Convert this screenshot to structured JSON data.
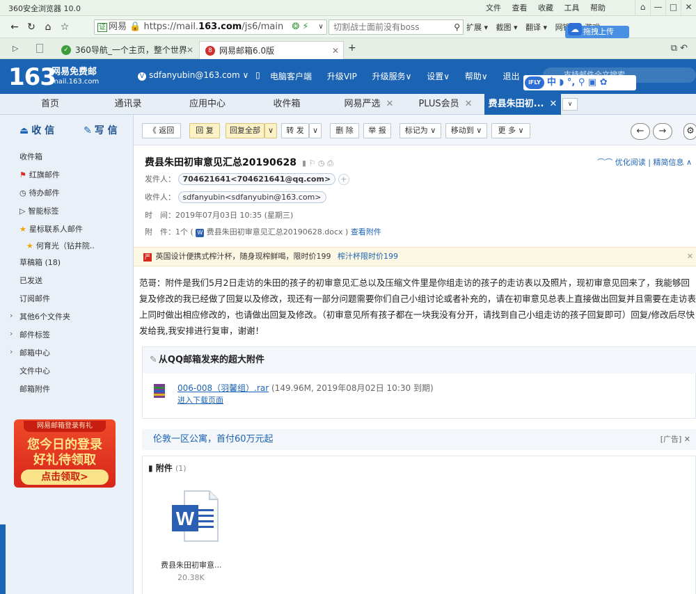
{
  "browser": {
    "title": "360安全浏览器 10.0",
    "menu": [
      "文件",
      "查看",
      "收藏",
      "工具",
      "帮助"
    ],
    "window_controls": [
      "⌂",
      "—",
      "□",
      "✕"
    ],
    "url_prefix": "网易",
    "url_plain": "https://mail.",
    "url_bold": "163.com",
    "url_tail": "/js6/main",
    "search_text": "切割战士面前没有boss",
    "toolbar_items": [
      "扩展 ▾",
      "截图 ▾",
      "翻译 ▾",
      "网银 ▾",
      "游戏 ▾",
      "»"
    ],
    "upload_tip": "拖拽上传",
    "tabs": [
      {
        "label": "360导航_一个主页，整个世界",
        "fav": "✓"
      },
      {
        "label": "网易邮箱6.0版",
        "fav": "8"
      }
    ]
  },
  "mail": {
    "logo_number": "163",
    "logo_title": "网易免费邮",
    "logo_domain": "mail.163.com",
    "account": "sdfanyubin@163.com ∨",
    "header_links": [
      "电脑客户端",
      "升级VIP",
      "升级服务∨",
      "设置∨",
      "帮助∨",
      "退出"
    ],
    "search_placeholder": "支持邮件全文搜索",
    "ifly_logo": "iFLY",
    "ifly_text": "中 ◗ °, ⚲ ▣ ✿",
    "nav_tabs": [
      "首页",
      "通讯录",
      "应用中心",
      "收件箱",
      "网易严选",
      "PLUS会员",
      "费县朱田初..."
    ],
    "sidebar": {
      "receive": "收 信",
      "write": "写 信",
      "items": [
        "收件箱",
        "红旗邮件",
        "待办邮件",
        "智能标签",
        "星标联系人邮件",
        "何育光（钻井院..",
        "草稿箱 (18)",
        "已发送",
        "订阅邮件",
        "其他6个文件夹",
        "邮件标签",
        "邮箱中心",
        "文件中心",
        "邮箱附件"
      ],
      "promo_top": "网易邮箱登录有礼",
      "promo_line1": "您今日的登录",
      "promo_line2": "好礼待领取",
      "promo_button": "点击领取>"
    },
    "actions": [
      "《 返回",
      "回 复",
      "回复全部",
      "∨",
      "转 发",
      "∨",
      "删 除",
      "举 报",
      "标记为 ∨",
      "移动到 ∨",
      "更 多 ∨"
    ],
    "subject": "费县朱田初审意见汇总20190628",
    "subject_icons": "▮ ⚐ ◷ ⎙",
    "read_options": "⌒⌒ 优化阅读 | 精简信息 ∧",
    "from_label": "发件人：",
    "from_value": "704621641<704621641@qq.com>",
    "to_label": "收件人：",
    "to_value": "sdfanyubin<sdfanyubin@163.com>",
    "time_label": "时　间：",
    "time_value": "2019年07月03日 10:35 (星期三)",
    "attach_label": "附　件：",
    "attach_count": "1个 (",
    "attach_file": "费县朱田初审意见汇总20190628.docx )",
    "attach_view": "查看附件",
    "ad_text": "英国设计便携式榨汁杯，随身现榨鲜喝，限时价199",
    "ad_link": "榨汁杯限时价199",
    "body": "范哥：附件是我们5月2日走访的朱田的孩子的初审意见汇总以及压缩文件里是你组走访的孩子的走访表以及照片，现初审意见回来了，我能够回复及修改的我已经做了回复以及修改，现还有一部分问题需要你们自己小组讨论或者补充的，请在初审意见总表上直接做出回复并且需要在走访表上同时做出相应修改的，也请做出回复及修改。（初审意见所有孩子都在一块我没有分开，请找到自己小组走访的孩子回复即可）回复/修改后尽快发给我,我安排进行复审，谢谢！",
    "qq_title": "从QQ邮箱发来的超大附件",
    "qq_file_name": "006-008（羽馨组）.rar",
    "qq_file_meta": " (149.96M, 2019年08月02日 10:30 到期)",
    "qq_download": "进入下载页面",
    "ad2_text": "伦敦一区公寓，首付60万元起",
    "ad2_tag": "[广告]  ✕",
    "att_title": "附件",
    "att_count": "(1)",
    "att_name": "费县朱田初审意...",
    "att_size": "20.38K"
  },
  "colors": {
    "brand_blue": "#1b63b3",
    "link_blue": "#1b63b3",
    "flag_red": "#d6291f"
  }
}
